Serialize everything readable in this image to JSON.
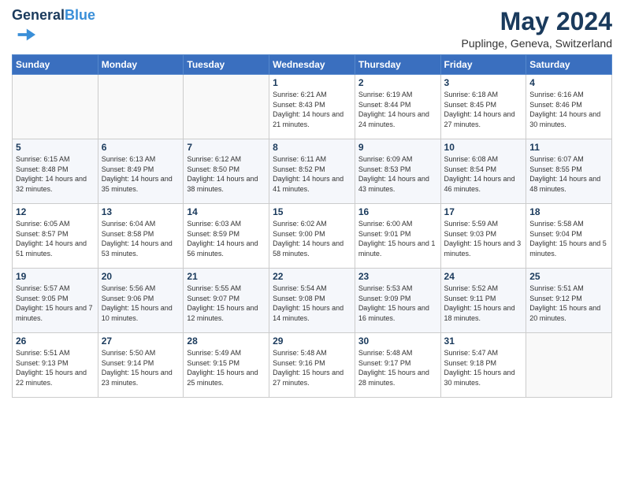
{
  "app": {
    "name": "GeneralBlue",
    "title": "May 2024",
    "subtitle": "Puplinge, Geneva, Switzerland"
  },
  "calendar": {
    "headers": [
      "Sunday",
      "Monday",
      "Tuesday",
      "Wednesday",
      "Thursday",
      "Friday",
      "Saturday"
    ],
    "weeks": [
      [
        {
          "day": "",
          "info": ""
        },
        {
          "day": "",
          "info": ""
        },
        {
          "day": "",
          "info": ""
        },
        {
          "day": "1",
          "info": "Sunrise: 6:21 AM\nSunset: 8:43 PM\nDaylight: 14 hours\nand 21 minutes."
        },
        {
          "day": "2",
          "info": "Sunrise: 6:19 AM\nSunset: 8:44 PM\nDaylight: 14 hours\nand 24 minutes."
        },
        {
          "day": "3",
          "info": "Sunrise: 6:18 AM\nSunset: 8:45 PM\nDaylight: 14 hours\nand 27 minutes."
        },
        {
          "day": "4",
          "info": "Sunrise: 6:16 AM\nSunset: 8:46 PM\nDaylight: 14 hours\nand 30 minutes."
        }
      ],
      [
        {
          "day": "5",
          "info": "Sunrise: 6:15 AM\nSunset: 8:48 PM\nDaylight: 14 hours\nand 32 minutes."
        },
        {
          "day": "6",
          "info": "Sunrise: 6:13 AM\nSunset: 8:49 PM\nDaylight: 14 hours\nand 35 minutes."
        },
        {
          "day": "7",
          "info": "Sunrise: 6:12 AM\nSunset: 8:50 PM\nDaylight: 14 hours\nand 38 minutes."
        },
        {
          "day": "8",
          "info": "Sunrise: 6:11 AM\nSunset: 8:52 PM\nDaylight: 14 hours\nand 41 minutes."
        },
        {
          "day": "9",
          "info": "Sunrise: 6:09 AM\nSunset: 8:53 PM\nDaylight: 14 hours\nand 43 minutes."
        },
        {
          "day": "10",
          "info": "Sunrise: 6:08 AM\nSunset: 8:54 PM\nDaylight: 14 hours\nand 46 minutes."
        },
        {
          "day": "11",
          "info": "Sunrise: 6:07 AM\nSunset: 8:55 PM\nDaylight: 14 hours\nand 48 minutes."
        }
      ],
      [
        {
          "day": "12",
          "info": "Sunrise: 6:05 AM\nSunset: 8:57 PM\nDaylight: 14 hours\nand 51 minutes."
        },
        {
          "day": "13",
          "info": "Sunrise: 6:04 AM\nSunset: 8:58 PM\nDaylight: 14 hours\nand 53 minutes."
        },
        {
          "day": "14",
          "info": "Sunrise: 6:03 AM\nSunset: 8:59 PM\nDaylight: 14 hours\nand 56 minutes."
        },
        {
          "day": "15",
          "info": "Sunrise: 6:02 AM\nSunset: 9:00 PM\nDaylight: 14 hours\nand 58 minutes."
        },
        {
          "day": "16",
          "info": "Sunrise: 6:00 AM\nSunset: 9:01 PM\nDaylight: 15 hours\nand 1 minute."
        },
        {
          "day": "17",
          "info": "Sunrise: 5:59 AM\nSunset: 9:03 PM\nDaylight: 15 hours\nand 3 minutes."
        },
        {
          "day": "18",
          "info": "Sunrise: 5:58 AM\nSunset: 9:04 PM\nDaylight: 15 hours\nand 5 minutes."
        }
      ],
      [
        {
          "day": "19",
          "info": "Sunrise: 5:57 AM\nSunset: 9:05 PM\nDaylight: 15 hours\nand 7 minutes."
        },
        {
          "day": "20",
          "info": "Sunrise: 5:56 AM\nSunset: 9:06 PM\nDaylight: 15 hours\nand 10 minutes."
        },
        {
          "day": "21",
          "info": "Sunrise: 5:55 AM\nSunset: 9:07 PM\nDaylight: 15 hours\nand 12 minutes."
        },
        {
          "day": "22",
          "info": "Sunrise: 5:54 AM\nSunset: 9:08 PM\nDaylight: 15 hours\nand 14 minutes."
        },
        {
          "day": "23",
          "info": "Sunrise: 5:53 AM\nSunset: 9:09 PM\nDaylight: 15 hours\nand 16 minutes."
        },
        {
          "day": "24",
          "info": "Sunrise: 5:52 AM\nSunset: 9:11 PM\nDaylight: 15 hours\nand 18 minutes."
        },
        {
          "day": "25",
          "info": "Sunrise: 5:51 AM\nSunset: 9:12 PM\nDaylight: 15 hours\nand 20 minutes."
        }
      ],
      [
        {
          "day": "26",
          "info": "Sunrise: 5:51 AM\nSunset: 9:13 PM\nDaylight: 15 hours\nand 22 minutes."
        },
        {
          "day": "27",
          "info": "Sunrise: 5:50 AM\nSunset: 9:14 PM\nDaylight: 15 hours\nand 23 minutes."
        },
        {
          "day": "28",
          "info": "Sunrise: 5:49 AM\nSunset: 9:15 PM\nDaylight: 15 hours\nand 25 minutes."
        },
        {
          "day": "29",
          "info": "Sunrise: 5:48 AM\nSunset: 9:16 PM\nDaylight: 15 hours\nand 27 minutes."
        },
        {
          "day": "30",
          "info": "Sunrise: 5:48 AM\nSunset: 9:17 PM\nDaylight: 15 hours\nand 28 minutes."
        },
        {
          "day": "31",
          "info": "Sunrise: 5:47 AM\nSunset: 9:18 PM\nDaylight: 15 hours\nand 30 minutes."
        },
        {
          "day": "",
          "info": ""
        }
      ]
    ]
  }
}
